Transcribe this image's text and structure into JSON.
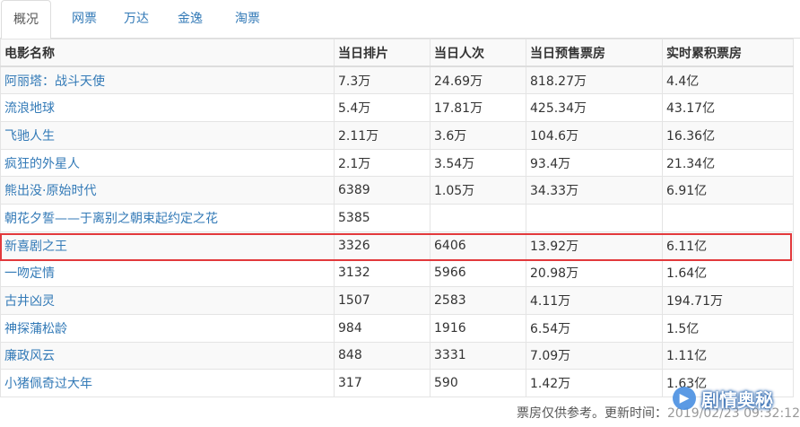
{
  "tabs": [
    {
      "label": "概况",
      "active": true
    },
    {
      "label": "网票",
      "active": false
    },
    {
      "label": "万达",
      "active": false
    },
    {
      "label": "金逸",
      "active": false
    },
    {
      "label": "淘票",
      "active": false
    }
  ],
  "table": {
    "headers": [
      "电影名称",
      "当日排片",
      "当日人次",
      "当日预售票房",
      "实时累积票房"
    ],
    "rows": [
      [
        "阿丽塔：战斗天使",
        "7.3万",
        "24.69万",
        "818.27万",
        "4.4亿"
      ],
      [
        "流浪地球",
        "5.4万",
        "17.81万",
        "425.34万",
        "43.17亿"
      ],
      [
        "飞驰人生",
        "2.11万",
        "3.6万",
        "104.6万",
        "16.36亿"
      ],
      [
        "疯狂的外星人",
        "2.1万",
        "3.54万",
        "93.4万",
        "21.34亿"
      ],
      [
        "熊出没·原始时代",
        "6389",
        "1.05万",
        "34.33万",
        "6.91亿"
      ],
      [
        "朝花夕誓——于离别之朝束起约定之花",
        "5385",
        "",
        "",
        ""
      ],
      [
        "新喜剧之王",
        "3326",
        "6406",
        "13.92万",
        "6.11亿"
      ],
      [
        "一吻定情",
        "3132",
        "5966",
        "20.98万",
        "1.64亿"
      ],
      [
        "古井凶灵",
        "1507",
        "2583",
        "4.11万",
        "194.71万"
      ],
      [
        "神探蒲松龄",
        "984",
        "1916",
        "6.54万",
        "1.5亿"
      ],
      [
        "廉政风云",
        "848",
        "3331",
        "7.09万",
        "1.11亿"
      ],
      [
        "小猪佩奇过大年",
        "317",
        "590",
        "1.42万",
        "1.63亿"
      ]
    ],
    "highlighted_row": "新喜剧之王"
  },
  "footer": {
    "note": "票房仅供参考。更新时间：",
    "time": "2019/02/23 09:32:12"
  },
  "watermark": {
    "text": "剧情奥秘",
    "icon": "play-logo-icon"
  },
  "colors": {
    "link": "#337ab7",
    "highlight_border": "#e2393c"
  }
}
